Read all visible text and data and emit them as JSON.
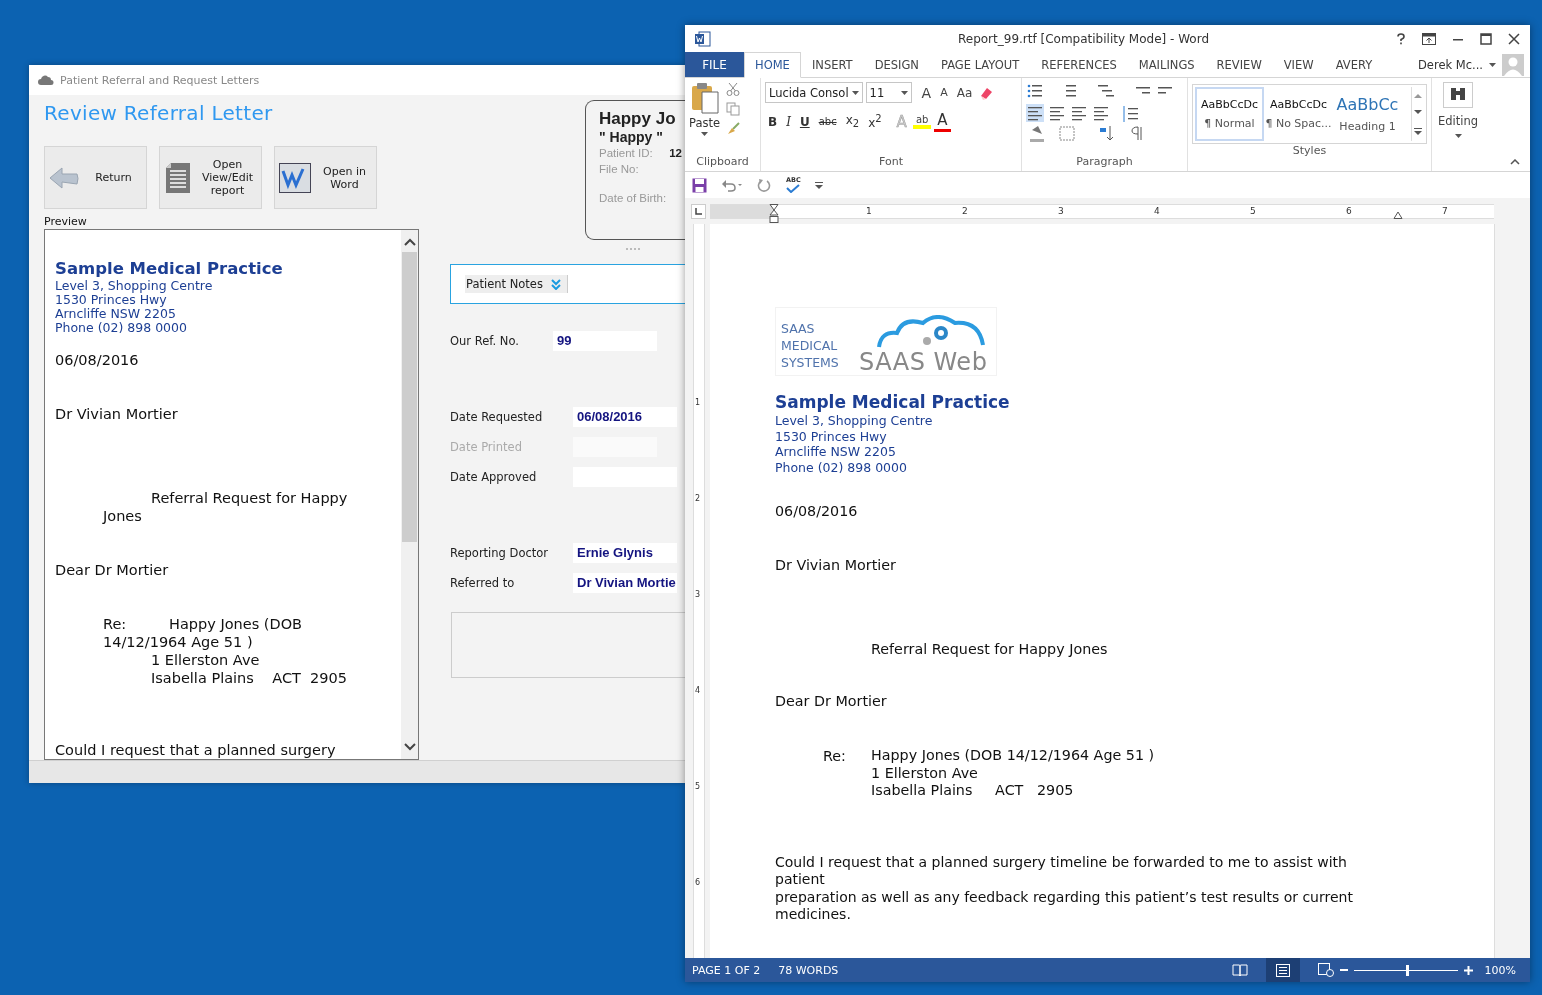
{
  "referral_window": {
    "title": "Patient Referral and Request Letters",
    "heading": "Review Referral Letter",
    "buttons": [
      {
        "label": "Return"
      },
      {
        "label": "Open View/Edit report"
      },
      {
        "label": "Open in Word"
      }
    ],
    "preview": {
      "label": "Preview",
      "practice_name": "Sample Medical Practice",
      "practice_address": [
        "Level 3, Shopping Centre",
        "1530 Princes Hwy",
        "Arncliffe NSW 2205",
        "Phone (02) 898 0000"
      ],
      "date": "06/08/2016",
      "recipient": "Dr Vivian Mortier",
      "subject": "Referral Request for Happy Jones",
      "salutation": "Dear Dr Mortier",
      "re_label": "Re:",
      "re_text": "Happy Jones (DOB 14/12/1964 Age 51 )",
      "re_address": [
        "1 Ellerston Ave",
        "Isabella Plains    ACT  2905"
      ],
      "body": "Could I request that a planned surgery"
    },
    "patient_card": {
      "name": "Happy Jo",
      "nickname": "\" Happy \"",
      "fields": [
        {
          "label": "Patient ID:",
          "value": "12"
        },
        {
          "label": "File No:"
        },
        {
          "label": "Date of Birth:"
        }
      ]
    },
    "patient_notes": "Patient Notes",
    "form_groups": [
      [
        {
          "label": "Our Ref. No.",
          "value": "99",
          "disabled": false
        }
      ],
      [
        {
          "label": "Date Requested",
          "value": "06/08/2016",
          "disabled": false
        },
        {
          "label": "Date Printed",
          "disabled": true
        },
        {
          "label": "Date Approved",
          "disabled": false
        }
      ],
      [
        {
          "label": "Reporting Doctor",
          "value": "Ernie Glynis",
          "disabled": false
        },
        {
          "label": "Referred to",
          "value": "Dr Vivian Mortie",
          "disabled": false
        }
      ]
    ]
  },
  "word_window": {
    "title": "Report_99.rtf [Compatibility Mode] - Word",
    "file_tab": "FILE",
    "tabs": [
      {
        "label": "HOME",
        "selected": true
      },
      {
        "label": "INSERT",
        "selected": false
      },
      {
        "label": "DESIGN",
        "selected": false
      },
      {
        "label": "PAGE LAYOUT",
        "selected": false
      },
      {
        "label": "REFERENCES",
        "selected": false
      },
      {
        "label": "MAILINGS",
        "selected": false
      },
      {
        "label": "REVIEW",
        "selected": false
      },
      {
        "label": "VIEW",
        "selected": false
      },
      {
        "label": "AVERY",
        "selected": false
      }
    ],
    "user": "Derek Mc...",
    "clipboard": {
      "paste_label": "Paste",
      "group_label": "Clipboard"
    },
    "font": {
      "name": "Lucida Consol",
      "size": "11",
      "grow_label": "A",
      "shrink_label": "A",
      "case_label": "Aa",
      "format_buttons": [
        {
          "kind": "bold",
          "label": "B"
        },
        {
          "kind": "italic",
          "label": "I"
        },
        {
          "kind": "underline",
          "label": "U"
        },
        {
          "kind": "strike",
          "label": "abc"
        },
        {
          "kind": "plain",
          "label": "x$_{2}$"
        },
        {
          "kind": "plain",
          "label": "x$^{2}$"
        }
      ],
      "effects_label": "A",
      "highlight_label": "ab",
      "color_label": "A",
      "group_label": "Font"
    },
    "paragraph": {
      "group_label": "Paragraph"
    },
    "styles": {
      "items": [
        {
          "preview": "AaBbCcDc",
          "name": "¶ Normal",
          "kind": "normal",
          "selected": true
        },
        {
          "preview": "AaBbCcDc",
          "name": "¶ No Spac...",
          "kind": "normal",
          "selected": false
        },
        {
          "preview": "AaBbCc",
          "name": "Heading 1",
          "kind": "heading",
          "selected": false
        }
      ],
      "group_label": "Styles"
    },
    "editing_label": "Editing",
    "spell_label": "ABC",
    "ruler_numbers": [
      "1",
      "2",
      "3",
      "4",
      "5",
      "6",
      "7"
    ],
    "vertical_ruler_numbers": [
      "1",
      "2",
      "3",
      "4",
      "5",
      "6"
    ],
    "document": {
      "logo_text": [
        "SAAS",
        "MEDICAL",
        "SYSTEMS"
      ],
      "logo_brand": "SAAS Web",
      "practice_name": "Sample Medical Practice",
      "practice_address": [
        "Level 3, Shopping Centre",
        "1530 Princes Hwy",
        "Arncliffe NSW 2205",
        "Phone (02) 898 0000"
      ],
      "date": "06/08/2016",
      "recipient": "Dr Vivian Mortier",
      "subject": "Referral Request for Happy Jones",
      "salutation": "Dear Dr Mortier",
      "re_label": "Re:",
      "re_lines": [
        "Happy Jones (DOB 14/12/1964 Age 51 )",
        "1 Ellerston Ave",
        "Isabella Plains     ACT   2905"
      ],
      "body_lines": [
        "Could I request that a planned surgery timeline be forwarded to me to assist with",
        "patient",
        "preparation as well as any feedback regarding this patient’s test results or current",
        "medicines."
      ]
    },
    "status": {
      "page": "PAGE 1 OF 2",
      "words": "78 WORDS",
      "level": 0.5,
      "zoom": "100%"
    }
  }
}
